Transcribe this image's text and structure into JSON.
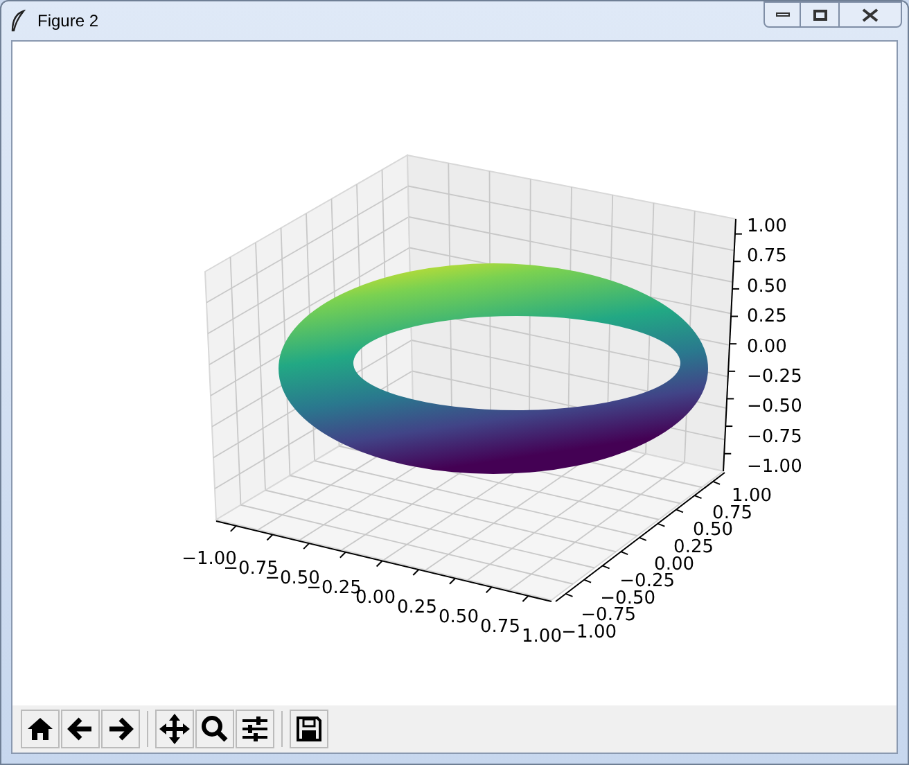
{
  "window": {
    "title": "Figure 2"
  },
  "plot": {
    "x_ticks": [
      "−1.00",
      "−0.75",
      "−0.50",
      "−0.25",
      "0.00",
      "0.25",
      "0.50",
      "0.75",
      "1.00"
    ],
    "y_ticks": [
      "−1.00",
      "−0.75",
      "−0.50",
      "−0.25",
      "0.00",
      "0.25",
      "0.50",
      "0.75",
      "1.00"
    ],
    "z_ticks": [
      "1.00",
      "0.75",
      "0.50",
      "0.25",
      "0.00",
      "−0.25",
      "−0.50",
      "−0.75",
      "−1.00"
    ]
  }
}
